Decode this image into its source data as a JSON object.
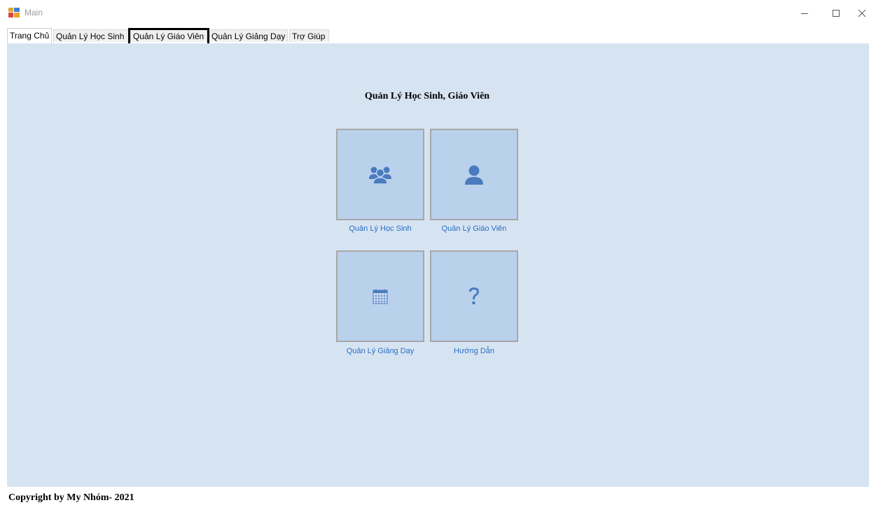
{
  "window": {
    "title": "Main",
    "icon": "app-window-icon",
    "controls": [
      "minimize-icon",
      "maximize-icon",
      "close-icon"
    ]
  },
  "tabs": [
    {
      "label": "Trang Chủ",
      "active": true
    },
    {
      "label": "Quản Lý Học Sinh",
      "active": false
    },
    {
      "label": "Quản Lý Giáo Viên",
      "active": false
    },
    {
      "label": "Quản Lý Giảng Dạy",
      "active": false
    },
    {
      "label": "Trợ Giúp",
      "active": false
    }
  ],
  "main": {
    "heading": "Quản Lý Học Sinh, Giáo Viên",
    "tiles": [
      {
        "label": "Quản Lý Học Sinh",
        "icon": "users-group-icon"
      },
      {
        "label": "Quản Lý Giáo Viên",
        "icon": "user-icon"
      },
      {
        "label": "Quản Lý Giảng Dạy",
        "icon": "calendar-icon"
      },
      {
        "label": "Hướng Dẫn",
        "icon": "question-mark-icon"
      }
    ]
  },
  "footer": {
    "copyright": "Copyright by My Nhóm- 2021"
  },
  "colors": {
    "panel_bg": "#d6e4f2",
    "tile_bg": "#bad1ec",
    "icon_color": "#4a7bbf",
    "link_color": "#2b6cc4",
    "highlight_border": "#000000"
  }
}
